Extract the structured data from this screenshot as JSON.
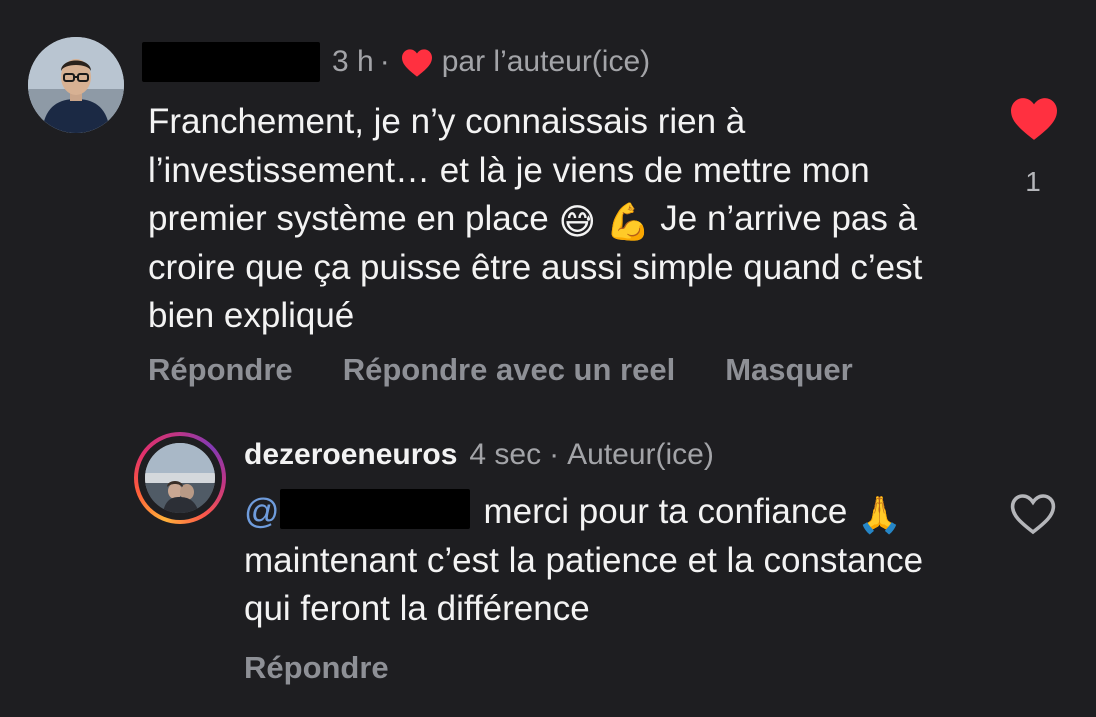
{
  "comment": {
    "username_redacted": true,
    "time": "3 h",
    "separator": "·",
    "liked_by_author_label": "par l’auteur(ice)",
    "text_before_emoji": "Franchement, je n’y connaissais rien à l’investissement… et là je viens de mettre mon premier système en place ",
    "emoji_1": "😅",
    "emoji_2": "💪",
    "text_after_emoji": " Je n’arrive pas à croire que ça puisse être aussi simple quand c’est bien expliqué",
    "like_count": "1",
    "actions": {
      "reply": "Répondre",
      "reply_with_reel": "Répondre avec un reel",
      "hide": "Masquer"
    }
  },
  "reply": {
    "username": "dezeroeneuros",
    "time": "4 sec",
    "separator": "·",
    "author_badge": "Auteur(ice)",
    "mention_prefix": "@",
    "text_part_1": "merci pour ta confiance ",
    "emoji": "🙏",
    "text_part_2": "  maintenant c’est la patience et la constance qui feront la différence",
    "actions": {
      "reply": "Répondre"
    }
  },
  "colors": {
    "background": "#1e1e21",
    "like_red": "#ff3040",
    "secondary_text": "#a3a4a8",
    "action_text": "#8e9096",
    "mention_blue": "#6f9cdc"
  },
  "icons": {
    "liked_heart": "heart-filled-icon",
    "unliked_heart": "heart-outline-icon"
  }
}
